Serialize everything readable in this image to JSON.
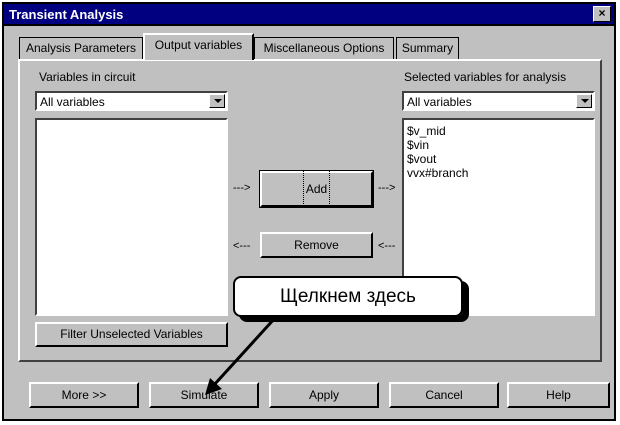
{
  "window": {
    "title": "Transient Analysis",
    "close_glyph": "×"
  },
  "tabs": [
    {
      "label": "Analysis Parameters",
      "active": false
    },
    {
      "label": "Output variables",
      "active": true
    },
    {
      "label": "Miscellaneous Options",
      "active": false
    },
    {
      "label": "Summary",
      "active": false
    }
  ],
  "left_panel": {
    "label": "Variables in circuit",
    "filter_value": "All variables",
    "items": [],
    "filter_button": "Filter Unselected Variables"
  },
  "right_panel": {
    "label": "Selected variables for analysis",
    "filter_value": "All variables",
    "items": [
      "$v_mid",
      "$vin",
      "$vout",
      "vvx#branch"
    ]
  },
  "transfer": {
    "add_label": "Add",
    "remove_label": "Remove",
    "arrow_right": "--->",
    "arrow_left": "<---"
  },
  "callout": {
    "text": "Щелкнем здесь"
  },
  "buttons": {
    "more": "More >>",
    "simulate": "Simulate",
    "apply": "Apply",
    "cancel": "Cancel",
    "help": "Help"
  },
  "icons": {
    "dropdown": "chevron-down-icon",
    "close": "close-icon",
    "pointer": "arrow-icon"
  },
  "colors": {
    "titlebar": "#000080",
    "face": "#c0c0c0",
    "window": "#ffffff"
  }
}
